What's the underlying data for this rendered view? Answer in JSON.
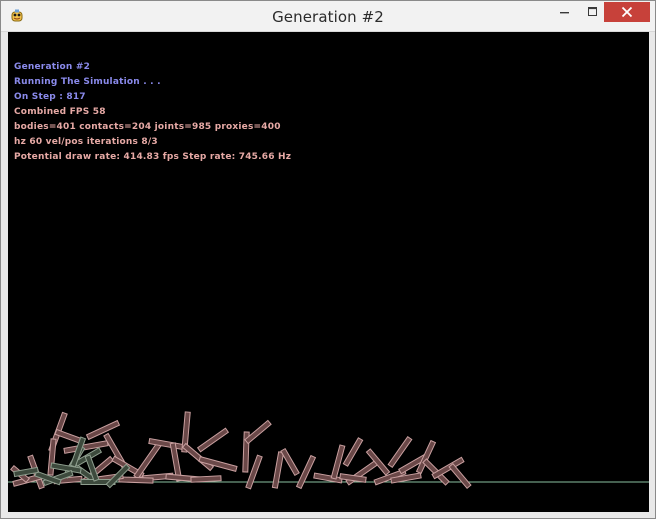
{
  "window": {
    "title": "Generation #2",
    "app_icon": "pygame-snake-icon",
    "controls": {
      "minimize_icon": "minimize-icon",
      "maximize_icon": "maximize-icon",
      "close_icon": "close-icon"
    }
  },
  "hud": {
    "generation": "Generation #2",
    "status": "Running The Simulation . . .",
    "step": "On Step : 817",
    "fps": "Combined FPS 58",
    "counts": "bodies=401 contacts=204 joints=985 proxies=400",
    "iterations": "hz 60 vel/pos iterations 8/3",
    "rates": "Potential draw rate: 414.83 fps Step rate: 745.66 Hz"
  },
  "colors": {
    "hud_primary": "#8a8aeb",
    "hud_secondary": "#e6a9a5",
    "ground_line": "#8ac0a0",
    "body_outline": "#c9a0a0",
    "body_fill": "#6a4848",
    "sleeping_outline": "#8f9f8f",
    "sleeping_fill": "#3d4a3d",
    "close_button": "#c7413a"
  }
}
